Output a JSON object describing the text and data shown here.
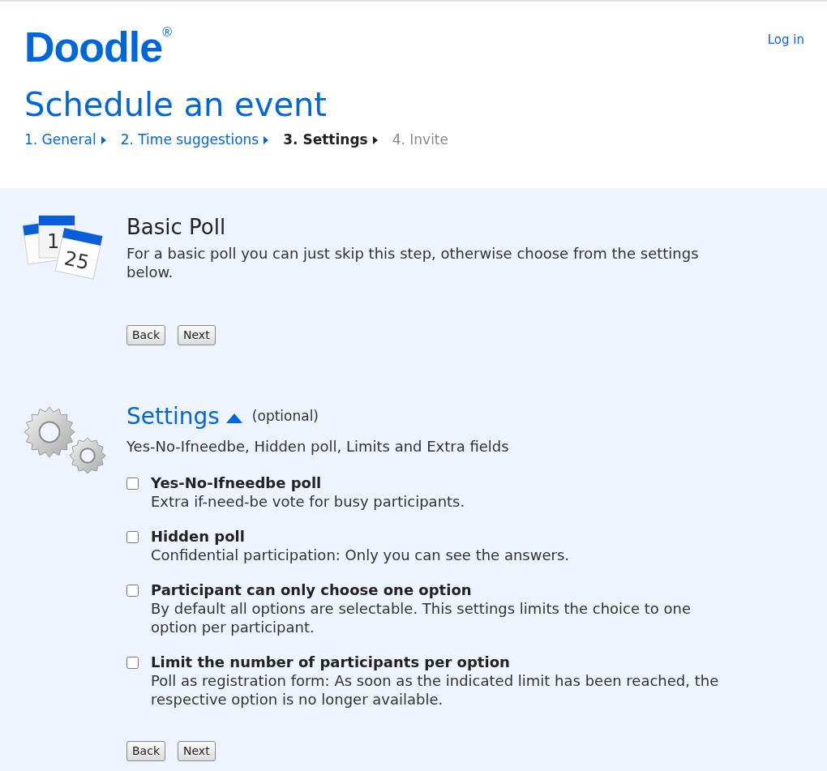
{
  "header": {
    "logo": "Doodle",
    "logo_mark": "®",
    "login": "Log in",
    "title": "Schedule an event",
    "steps": [
      {
        "label": "1. General",
        "selected": false,
        "disabled": false
      },
      {
        "label": "2. Time suggestions",
        "selected": false,
        "disabled": false
      },
      {
        "label": "3. Settings",
        "selected": true,
        "disabled": false
      },
      {
        "label": "4. Invite",
        "selected": false,
        "disabled": true
      }
    ]
  },
  "basic_poll": {
    "icon_days": [
      "1",
      "25"
    ],
    "title": "Basic Poll",
    "description": "For a basic poll you can just skip this step, otherwise choose from the settings below.",
    "buttons": [
      "Back",
      "Next"
    ]
  },
  "settings": {
    "title": "Settings",
    "expanded": true,
    "optional": "(optional)",
    "summary": "Yes-No-Ifneedbe, Hidden poll, Limits and Extra fields",
    "options": [
      {
        "label": "Yes-No-Ifneedbe poll",
        "description": "Extra if-need-be vote for busy participants.",
        "checked": false
      },
      {
        "label": "Hidden poll",
        "description": "Confidential participation: Only you can see the answers.",
        "checked": false
      },
      {
        "label": "Participant can only choose one option",
        "description": "By default all options are selectable. This settings limits the choice to one option per participant.",
        "checked": false
      },
      {
        "label": "Limit the number of participants per option",
        "description": "Poll as registration form: As soon as the indicated limit has been reached, the respective option is no longer available.",
        "checked": false
      }
    ],
    "buttons": [
      "Back",
      "Next"
    ]
  }
}
